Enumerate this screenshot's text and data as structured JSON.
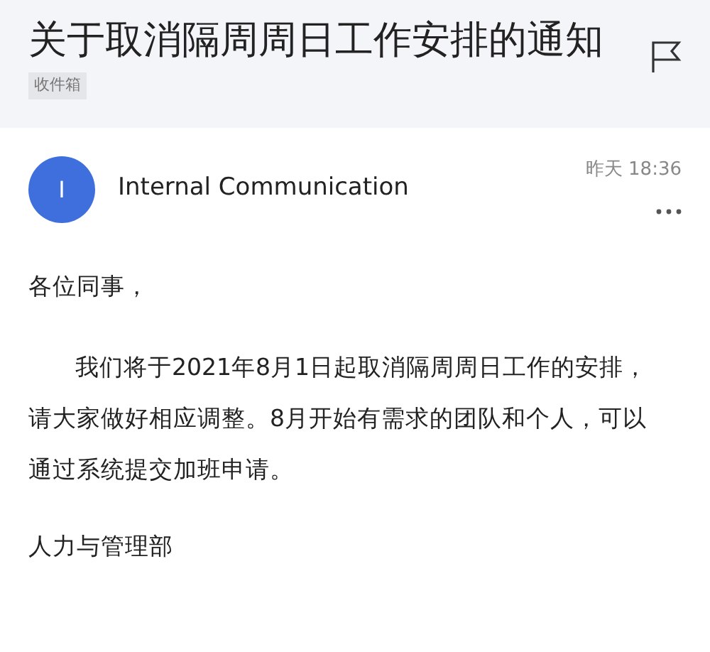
{
  "header": {
    "subject": "关于取消隔周周日工作安排的通知",
    "folder_tag": "收件箱"
  },
  "message": {
    "sender_initial": "I",
    "sender": "Internal Communication",
    "time": "昨天 18:36",
    "greeting": "各位同事，",
    "paragraphs": [
      "我们将于2021年8月1日起取消隔周周日工作的安排，请大家做好相应调整。8月开始有需求的团队和个人，可以通过系统提交加班申请。"
    ],
    "signature": "人力与管理部"
  }
}
